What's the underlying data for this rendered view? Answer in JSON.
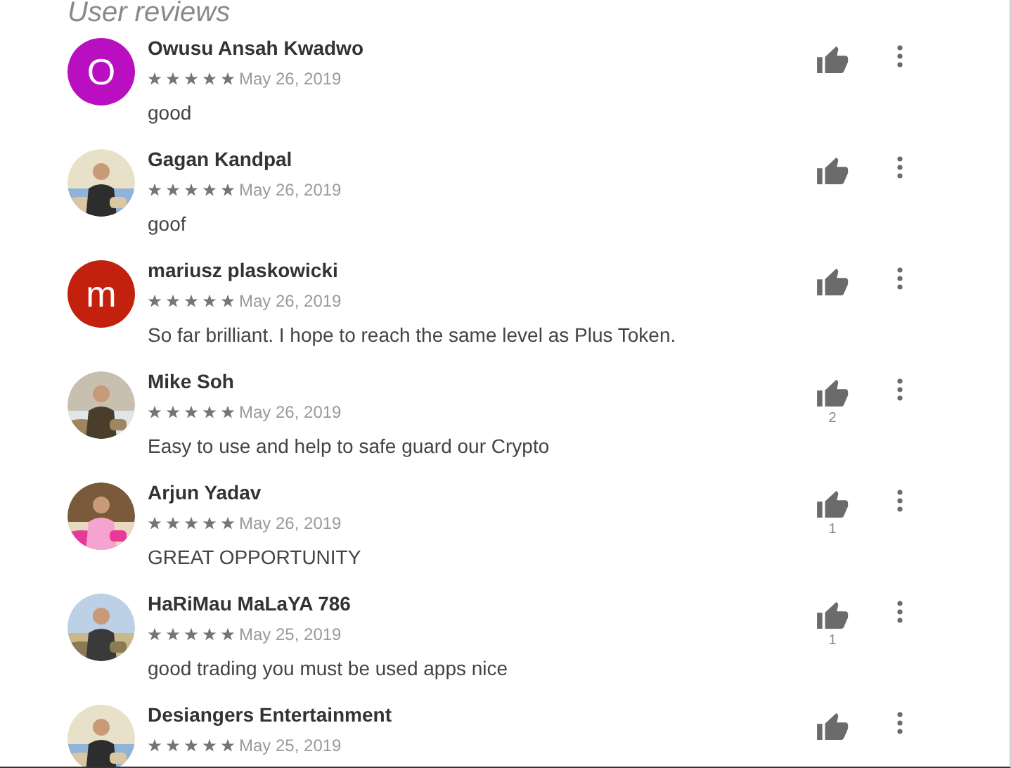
{
  "section_title": "User reviews",
  "reviews": [
    {
      "author": "Owusu Ansah Kwadwo",
      "avatar": {
        "kind": "letter",
        "letter": "O",
        "color": "#b90fc0"
      },
      "stars": 5,
      "date": "May 26, 2019",
      "text": "good"
    },
    {
      "author": "Gagan Kandpal",
      "stars": 5,
      "date": "May 26, 2019",
      "text": "goof"
    },
    {
      "author": "mariusz plaskowicki",
      "avatar": {
        "kind": "letter",
        "letter": "m",
        "color": "#c4200e"
      },
      "stars": 5,
      "date": "May 26, 2019",
      "text": "So far brilliant. I hope to reach the same level as Plus Token."
    },
    {
      "author": "Mike Soh",
      "stars": 5,
      "date": "May 26, 2019",
      "text": "Easy to use and help to safe guard our Crypto",
      "likes": "2"
    },
    {
      "author": "Arjun Yadav",
      "stars": 5,
      "date": "May 26, 2019",
      "text": "GREAT OPPORTUNITY",
      "likes": "1"
    },
    {
      "author": "HaRiMau MaLaYA 786",
      "stars": 5,
      "date": "May 25, 2019",
      "text": "good trading you must be used apps nice",
      "likes": "1"
    },
    {
      "author": "Desiangers Entertainment",
      "stars": 5,
      "date": "May 25, 2019"
    }
  ]
}
